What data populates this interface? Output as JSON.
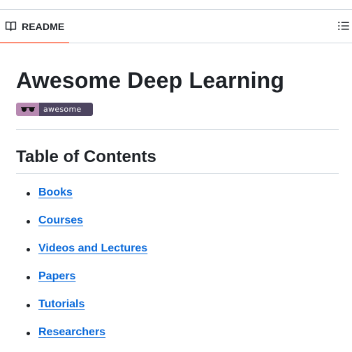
{
  "header": {
    "tab_label": "README",
    "tab_icon": "book-icon",
    "outline_icon": "list-unordered-icon",
    "active_tab_color": "#fd8c73"
  },
  "readme": {
    "title": "Awesome Deep Learning",
    "badge": {
      "icon": "sunglasses-icon",
      "text": "awesome",
      "left_color": "#b789b1",
      "right_color": "#4d4560"
    },
    "toc_heading": "Table of Contents",
    "toc_items": [
      {
        "label": "Books"
      },
      {
        "label": "Courses"
      },
      {
        "label": "Videos and Lectures"
      },
      {
        "label": "Papers"
      },
      {
        "label": "Tutorials"
      },
      {
        "label": "Researchers"
      }
    ],
    "link_color": "#0969da"
  }
}
